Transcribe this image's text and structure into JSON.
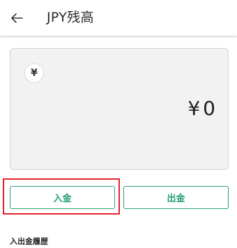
{
  "header": {
    "title": "JPY残高",
    "back_icon": "arrow-left-icon"
  },
  "balance_card": {
    "currency_symbol": "¥",
    "amount": "¥0"
  },
  "actions": {
    "deposit_label": "入金",
    "withdraw_label": "出金",
    "accent_color": "#26a17c",
    "highlight_color": "#e3232a"
  },
  "history": {
    "title": "入出金履歴"
  }
}
